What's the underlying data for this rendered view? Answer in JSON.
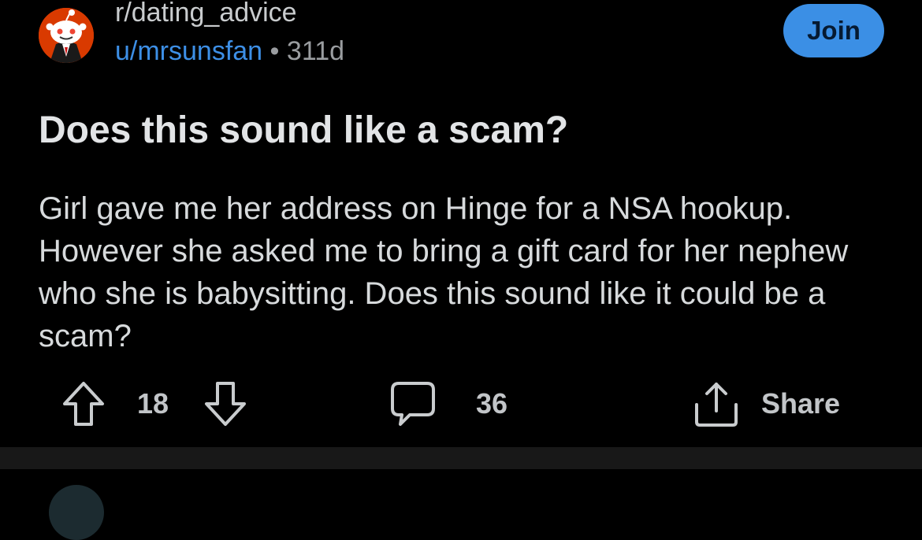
{
  "post": {
    "subreddit": "r/dating_advice",
    "author": "u/mrsunsfan",
    "separator": "•",
    "age": "311d",
    "join_label": "Join",
    "title": "Does this sound like a scam?",
    "body": "Girl gave me her address on Hinge for a NSA hookup. However she asked me to bring a gift card for her nephew who she is babysitting. Does this sound like it could be a scam?"
  },
  "actions": {
    "upvotes": "18",
    "comments": "36",
    "share_label": "Share"
  },
  "icons": {
    "avatar": "reddit-snoo-avatar-icon",
    "upvote": "arrow-up-icon",
    "downvote": "arrow-down-icon",
    "comment": "speech-bubble-icon",
    "share": "share-upload-icon"
  },
  "colors": {
    "background": "#000000",
    "accent": "#3b8fe5",
    "author_link": "#3d8fe6",
    "avatar_bg": "#d93a00"
  }
}
